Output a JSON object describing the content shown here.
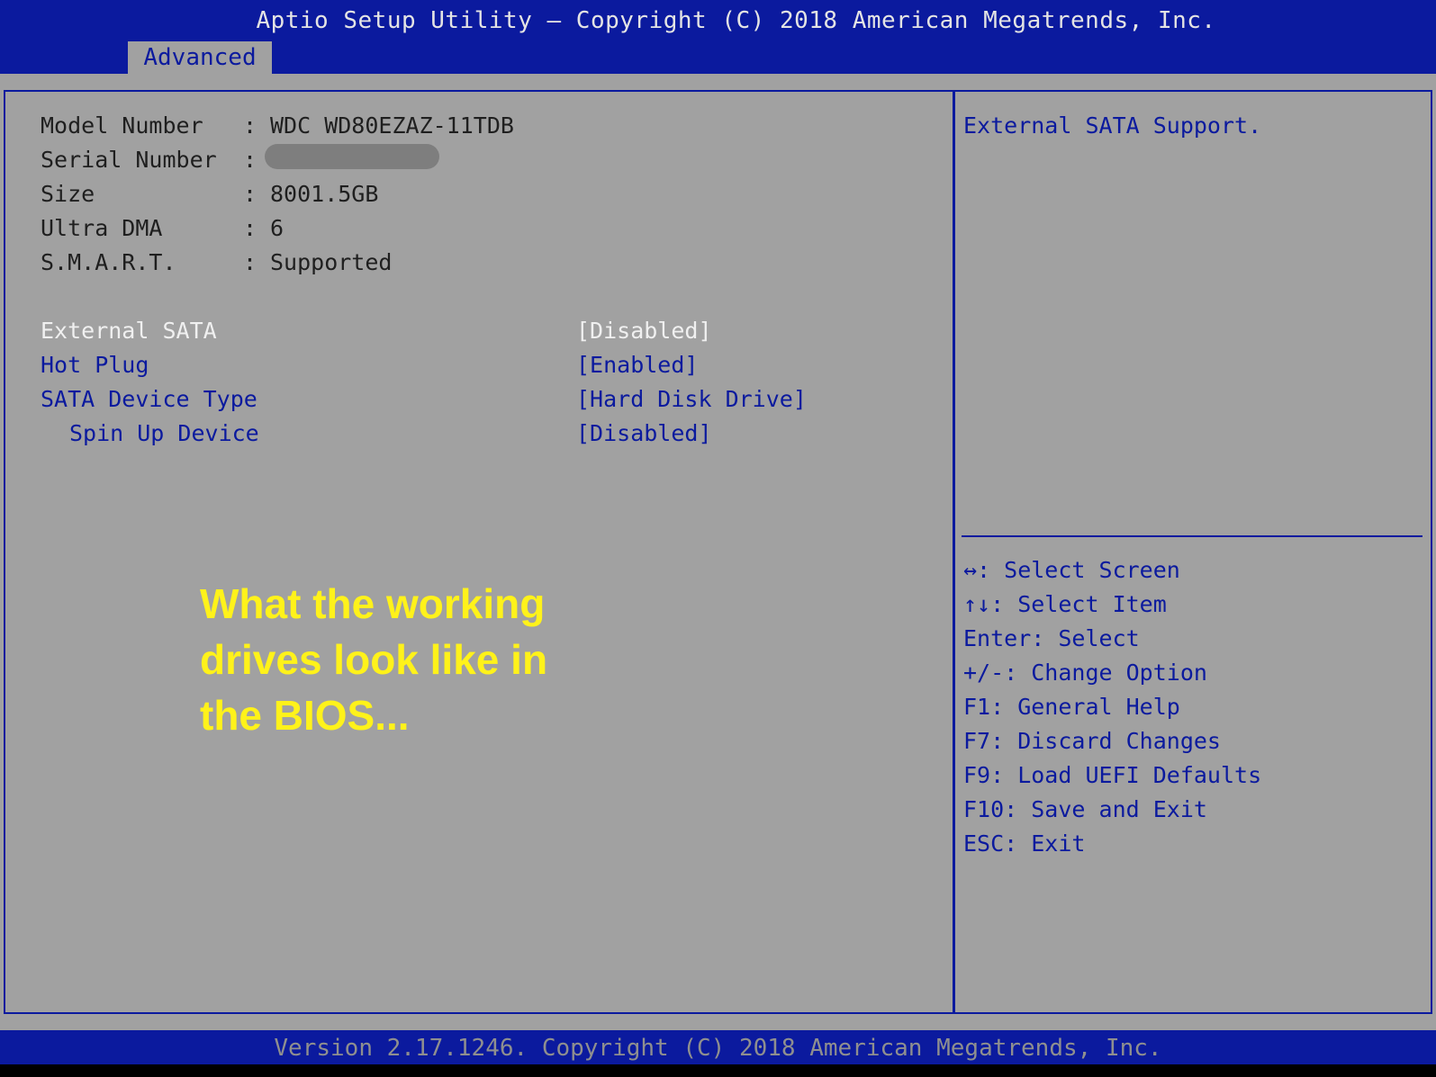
{
  "header": {
    "title": "Aptio Setup Utility – Copyright (C) 2018 American Megatrends, Inc.",
    "active_tab": "Advanced"
  },
  "device_info": [
    {
      "label": "Model Number",
      "sep": ":",
      "value": "WDC WD80EZAZ-11TDB"
    },
    {
      "label": "Serial Number",
      "sep": ":",
      "value": ""
    },
    {
      "label": "Size",
      "sep": ":",
      "value": "8001.5GB"
    },
    {
      "label": "Ultra DMA",
      "sep": ":",
      "value": "6"
    },
    {
      "label": "S.M.A.R.T.",
      "sep": ":",
      "value": "Supported"
    }
  ],
  "options": [
    {
      "label": "External SATA",
      "value": "[Disabled]",
      "selected": true
    },
    {
      "label": "Hot Plug",
      "value": "[Enabled]",
      "selected": false
    },
    {
      "label": "SATA Device Type",
      "value": "[Hard Disk Drive]",
      "selected": false
    },
    {
      "label": "Spin Up Device",
      "value": "[Disabled]",
      "selected": false
    }
  ],
  "annotation": {
    "line1": "What the working",
    "line2": "drives look like in",
    "line3": "the BIOS..."
  },
  "help": {
    "description": "External SATA Support.",
    "keys": [
      "↔: Select Screen",
      "↑↓: Select Item",
      "Enter: Select",
      "+/-: Change Option",
      "F1: General Help",
      "F7: Discard Changes",
      "F9: Load UEFI Defaults",
      "F10: Save and Exit",
      "ESC: Exit"
    ]
  },
  "footer": {
    "version": "Version 2.17.1246. Copyright (C) 2018 American Megatrends, Inc."
  },
  "colors": {
    "bios_blue": "#0b1a9e",
    "panel_grey": "#a1a1a1",
    "annotation_yellow": "#fff21a"
  }
}
